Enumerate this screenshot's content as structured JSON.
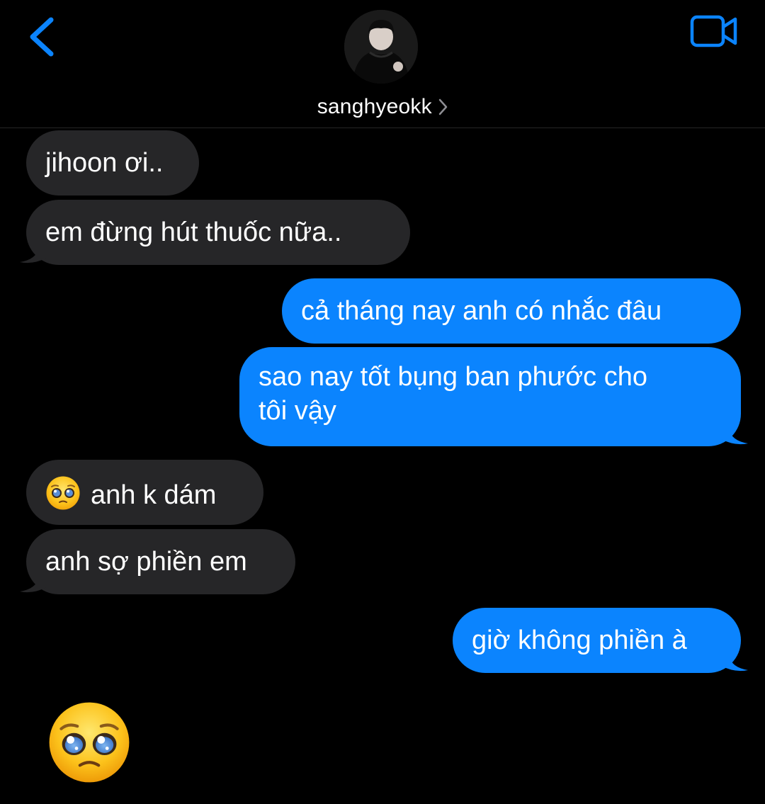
{
  "header": {
    "contact_name": "sanghyeokk",
    "icons": {
      "back": "chevron-left-icon",
      "video": "video-camera-icon",
      "name_chevron": "chevron-right-icon"
    }
  },
  "colors": {
    "accent": "#0b84fe",
    "incoming_bubble": "#262628",
    "outgoing_bubble": "#0b84fe",
    "background": "#000000"
  },
  "messages": [
    {
      "direction": "incoming",
      "text": "jihoon ơi.."
    },
    {
      "direction": "incoming",
      "text": "em đừng hút thuốc nữa.."
    },
    {
      "direction": "outgoing",
      "text": "cả tháng nay anh có nhắc đâu"
    },
    {
      "direction": "outgoing",
      "line1": "sao nay tốt bụng ban phước cho",
      "line2": "tôi vậy"
    },
    {
      "direction": "incoming",
      "text": "anh k dám",
      "emoji": "pleading-face"
    },
    {
      "direction": "incoming",
      "text": "anh sợ phiền em"
    },
    {
      "direction": "outgoing",
      "text": "giờ không phiền à"
    },
    {
      "direction": "incoming",
      "emoji": "pleading-face-large"
    }
  ]
}
